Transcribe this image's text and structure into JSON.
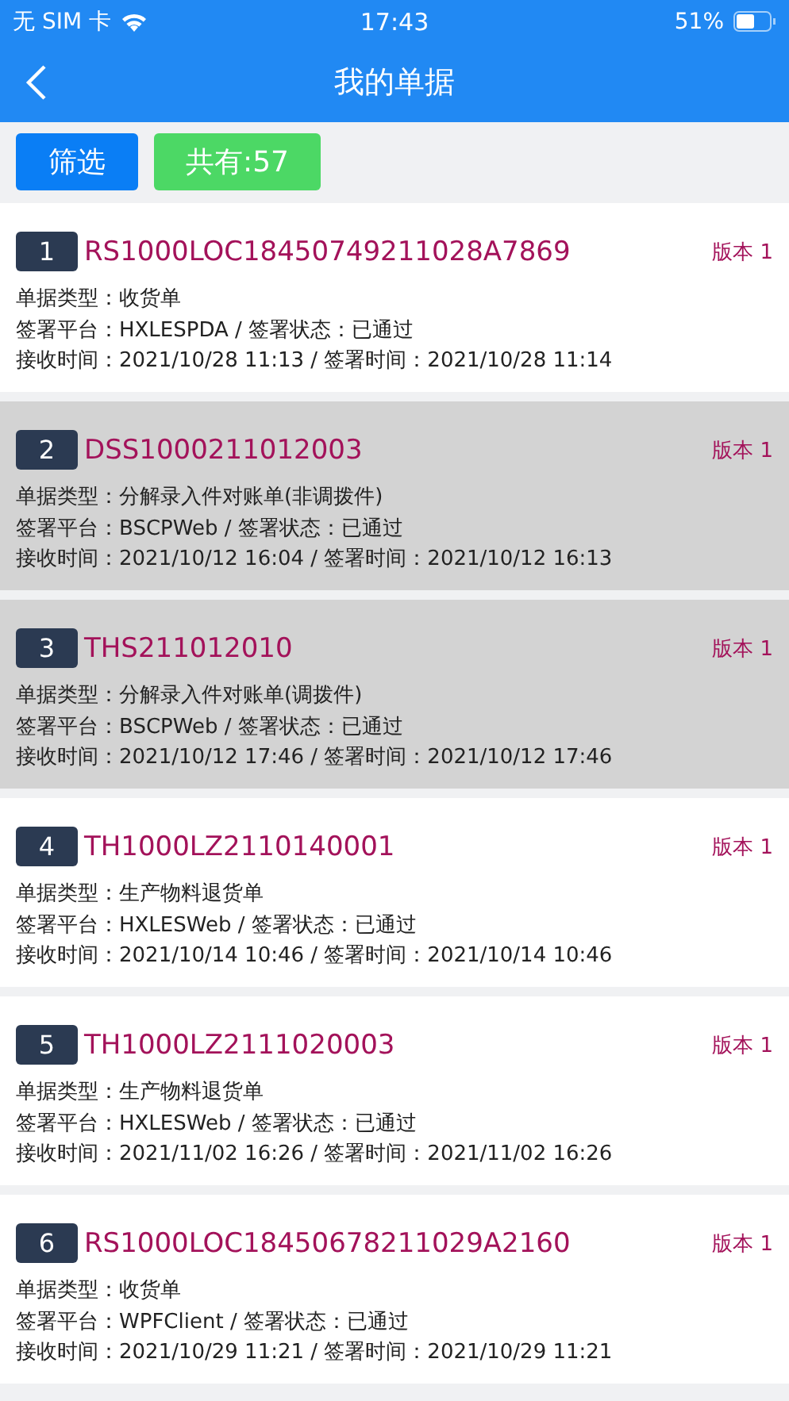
{
  "status_bar": {
    "carrier": "无 SIM 卡",
    "time": "17:43",
    "battery": "51%"
  },
  "nav": {
    "title": "我的单据"
  },
  "toolbar": {
    "filter": "筛选",
    "count": "共有:57"
  },
  "documents": [
    {
      "index": "1",
      "number": "RS1000LOC18450749211028A7869",
      "version": "版本 1",
      "selected": false,
      "lines": [
        "单据类型：收货单",
        "签署平台：HXLESPDA / 签署状态：已通过",
        "接收时间：2021/10/28 11:13 / 签署时间：2021/10/28 11:14"
      ]
    },
    {
      "index": "2",
      "number": "DSS1000211012003",
      "version": "版本 1",
      "selected": true,
      "lines": [
        "单据类型：分解录入件对账单(非调拨件)",
        "签署平台：BSCPWeb / 签署状态：已通过",
        "接收时间：2021/10/12 16:04 / 签署时间：2021/10/12 16:13"
      ]
    },
    {
      "index": "3",
      "number": "THS211012010",
      "version": "版本 1",
      "selected": true,
      "lines": [
        "单据类型：分解录入件对账单(调拨件)",
        "签署平台：BSCPWeb / 签署状态：已通过",
        "接收时间：2021/10/12 17:46 / 签署时间：2021/10/12 17:46"
      ]
    },
    {
      "index": "4",
      "number": "TH1000LZ2110140001",
      "version": "版本 1",
      "selected": false,
      "lines": [
        "单据类型：生产物料退货单",
        "签署平台：HXLESWeb / 签署状态：已通过",
        "接收时间：2021/10/14 10:46 / 签署时间：2021/10/14 10:46"
      ]
    },
    {
      "index": "5",
      "number": "TH1000LZ2111020003",
      "version": "版本 1",
      "selected": false,
      "lines": [
        "单据类型：生产物料退货单",
        "签署平台：HXLESWeb / 签署状态：已通过",
        "接收时间：2021/11/02 16:26 / 签署时间：2021/11/02 16:26"
      ]
    },
    {
      "index": "6",
      "number": "RS1000LOC18450678211029A2160",
      "version": "版本 1",
      "selected": false,
      "lines": [
        "单据类型：收货单",
        "签署平台：WPFClient / 签署状态：已通过",
        "接收时间：2021/10/29 11:21 / 签署时间：2021/10/29 11:21"
      ]
    }
  ]
}
